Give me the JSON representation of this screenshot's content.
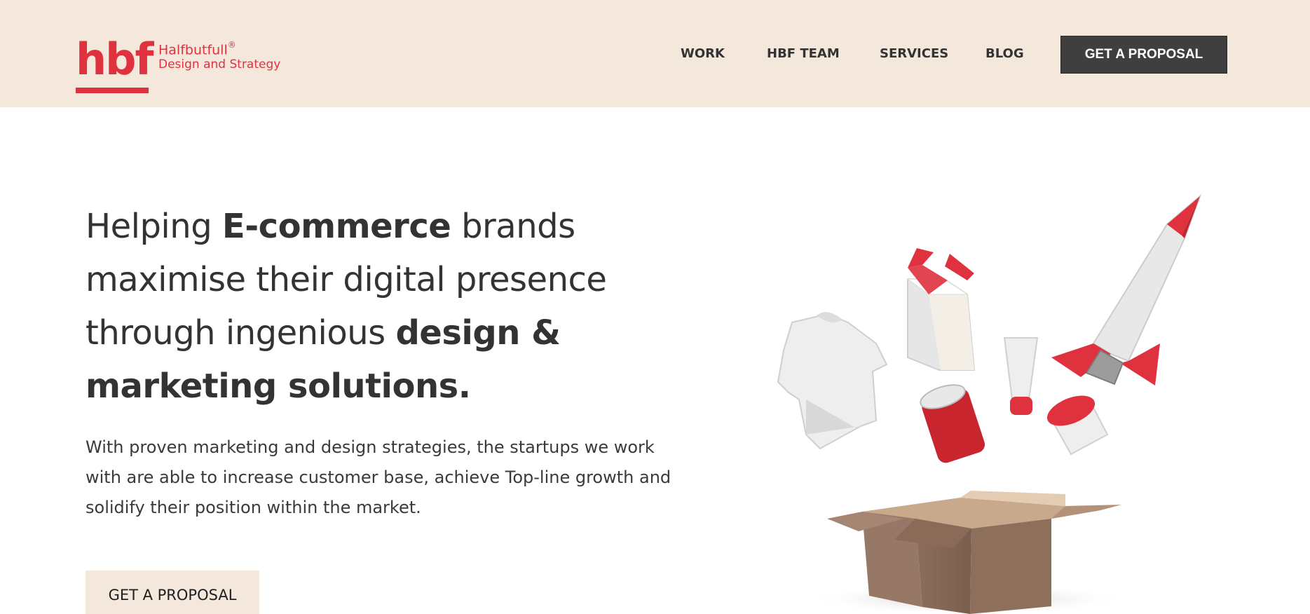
{
  "header": {
    "logo_mark": "hbf",
    "logo_name": "Halfbutfull",
    "logo_registered": "®",
    "logo_tagline": "Design and Strategy",
    "nav": [
      "WORK",
      "HBF TEAM",
      "SERVICES",
      "BLOG"
    ],
    "cta_label": "GET A PROPOSAL"
  },
  "hero": {
    "title_parts": {
      "p1": "Helping ",
      "b1": "E-commerce",
      "p2": " brands maximise their digital presence through ingenious ",
      "b2": "design & marketing solutions."
    },
    "subtitle": "With proven marketing and design strategies, the startups we work with are able to increase customer base, achieve Top-line growth and solidify their position within the market.",
    "cta_label": "GET A PROPOSAL"
  },
  "illustration": {
    "items": [
      "tshirt-icon",
      "product-box-icon",
      "rocket-icon",
      "tube-icon",
      "can-icon",
      "jar-icon",
      "cardboard-box-icon"
    ]
  },
  "colors": {
    "brand_red": "#e0323e",
    "header_bg": "#f4e8dc",
    "header_button_bg": "#3f3f3f",
    "text": "#333333"
  }
}
